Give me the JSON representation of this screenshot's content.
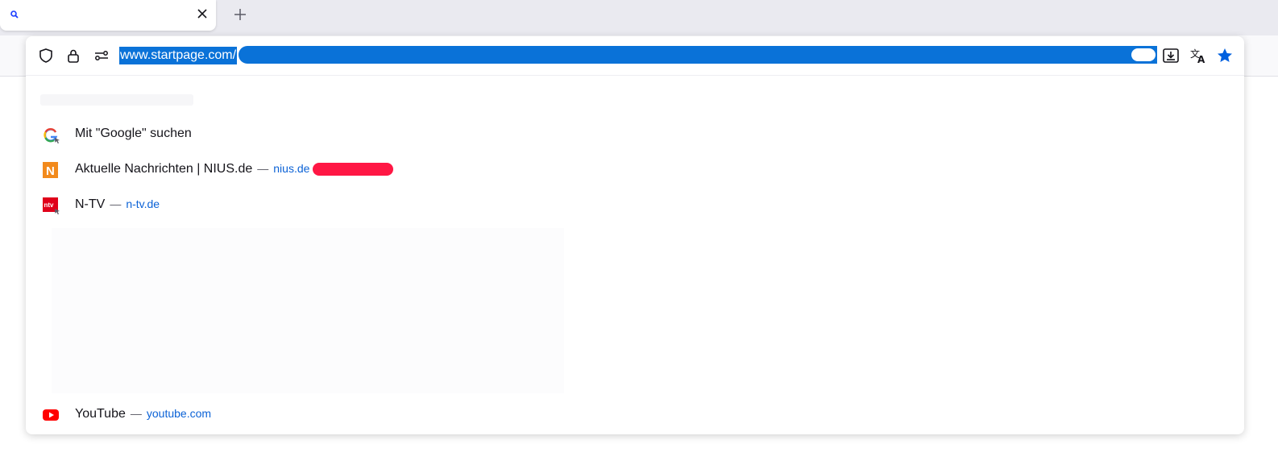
{
  "tab": {
    "title": ""
  },
  "urlbar": {
    "url_visible": "www.startpage.com/"
  },
  "suggestions": [
    {
      "title": "Mit \"Google\" suchen",
      "domain": "",
      "icon": "google-icon"
    },
    {
      "title": "Aktuelle Nachrichten | NIUS.de",
      "domain": "nius.de",
      "icon": "nius-icon"
    },
    {
      "title": "N-TV",
      "domain": "n-tv.de",
      "icon": "ntv-icon"
    },
    {
      "title": "YouTube",
      "domain": "youtube.com",
      "icon": "youtube-icon"
    }
  ],
  "separator": "—",
  "colors": {
    "accent": "#0a72d8",
    "link": "#0b62d6",
    "star": "#0060df"
  }
}
